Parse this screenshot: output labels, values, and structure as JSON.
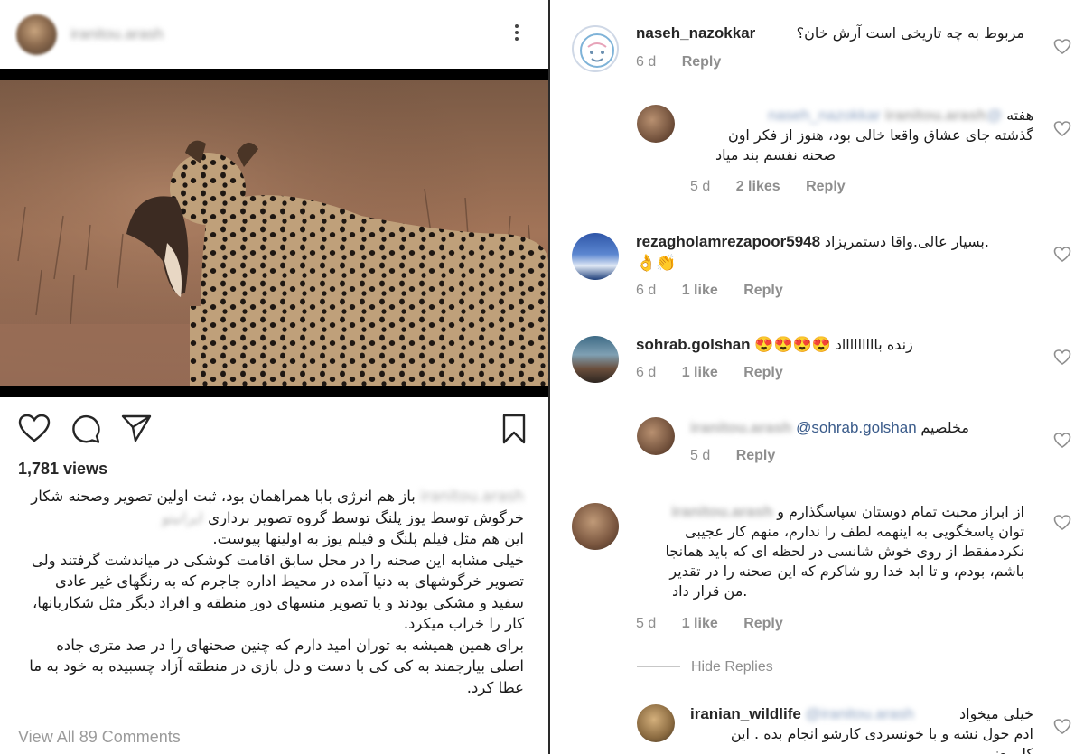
{
  "post": {
    "username": "iranitou.arash",
    "views": "1,781 views",
    "caption": {
      "line1_text": "باز هم انرژی بابا همراهمان بود، ثبت اولین تصویر وصحنه شکار",
      "line1_name": "iranitou.arash",
      "line2_text": "خرگوش توسط یوز پلنگ توسط گروه تصویر برداری",
      "line2_name": "ایرانیتو",
      "line3": "این هم مثل فیلم پلنگ و فیلم یوز به اولینها پیوست.",
      "line4": "خیلی مشابه این صحنه را در محل سابق اقامت کوشکی در میاندشت گرفتند ولی",
      "line5": "تصویر خرگوشهای به دنیا آمده در محیط اداره جاجرم که به رنگهای غیر عادی",
      "line6": "سفید و مشکی بودند و یا تصویر منسهای دور منطقه و افراد دیگر مثل شکاربانها،",
      "line7": "کار را خراب میکرد.",
      "line8": "برای همین همیشه به توران امید دارم که چنین صحنهای را در صد متری جاده",
      "line9": "اصلی بیارجمند به کی کی با دست و دل بازی در منطقه آزاد چسبیده به خود به ما",
      "line10": "عطا کرد."
    },
    "view_all": "View All 89 Comments"
  },
  "comments": [
    {
      "user": "naseh_nazokkar",
      "text": "مربوط به چه تاریخی است آرش خان؟",
      "time": "6 d",
      "likes": "",
      "reply": "Reply"
    },
    {
      "user": "iranitou.arash",
      "mention": "@naseh_nazokkar",
      "text_l1": "هفته",
      "text_l2": "گذشته جای عشاق واقعا خالی بود، هنوز از فکر اون",
      "text_l3": "صحنه نفسم بند میاد",
      "time": "5 d",
      "likes": "2 likes",
      "reply": "Reply"
    },
    {
      "user": "rezagholamrezapoor5948",
      "text": "بسیار عالی.واقا دستمریزاد.",
      "emoji": "👌👏",
      "time": "6 d",
      "likes": "1 like",
      "reply": "Reply"
    },
    {
      "user": "sohrab.golshan",
      "text": "زنده باااااااااد",
      "emoji": "😍😍😍😍",
      "time": "6 d",
      "likes": "1 like",
      "reply": "Reply"
    },
    {
      "user": "iranitou.arash",
      "mention": "@sohrab.golshan",
      "text": "مخلصیم",
      "time": "5 d",
      "likes": "",
      "reply": "Reply"
    },
    {
      "user": "iranitou.arash",
      "text_l1": "از ابراز محبت تمام دوستان سپاسگذارم و",
      "text_l2": "توان پاسخگویی به اینهمه لطف را ندارم، منهم کار عجیبی",
      "text_l3": "نکردمفقط از روی خوش شانسی در لحظه ای که باید همانجا",
      "text_l4": "باشم، بودم، و تا ابد خدا رو شاکرم که این صحنه را در تقدیر",
      "text_l5": ".من قرار داد",
      "time": "5 d",
      "likes": "1 like",
      "reply": "Reply"
    },
    {
      "user": "iranian_wildlife",
      "mention": "@iranitou.arash",
      "text_l1": "خیلی میخواد",
      "text_l2": "ادم حول نشه و با خونسردی کارشو انجام بده . این",
      "text_l3": "کار یعنی ..."
    }
  ],
  "hide_replies": "Hide Replies",
  "colors": {
    "mention": "#3a5b8a",
    "meta": "#8e8e8e",
    "divider": "#2a2a2a"
  }
}
